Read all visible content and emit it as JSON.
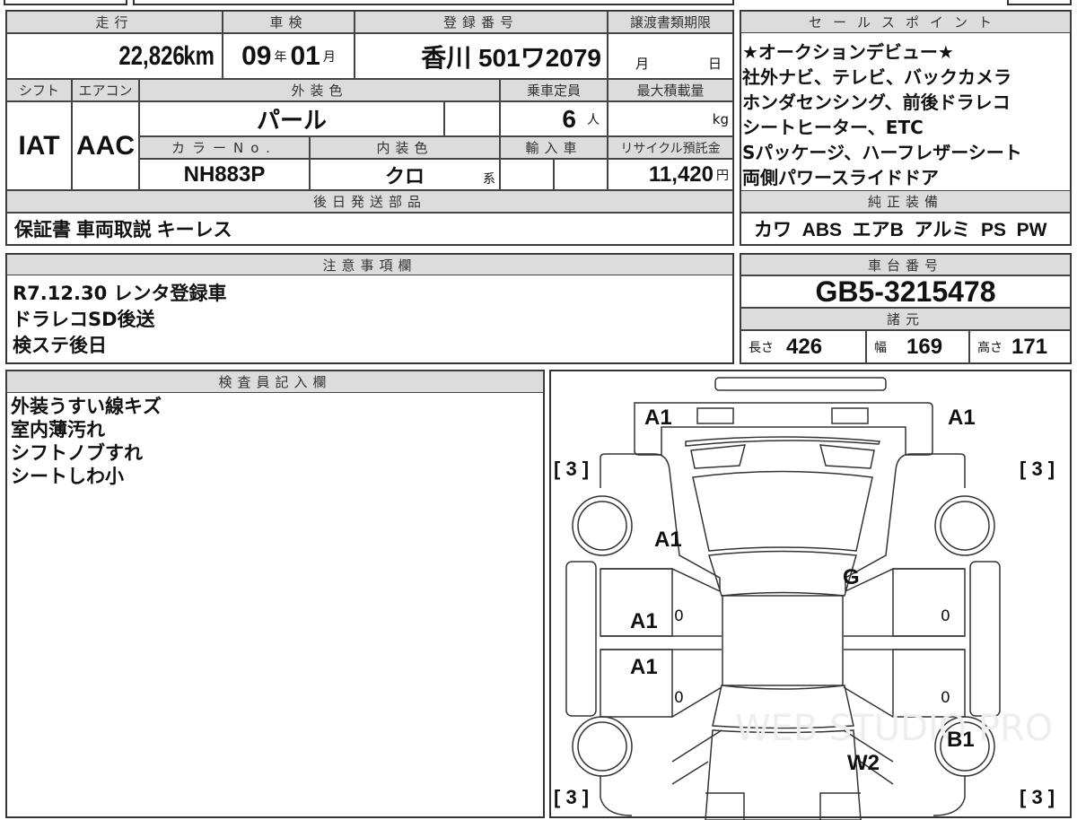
{
  "vehicle": {
    "mileage_label": "走行",
    "mileage": "22,826",
    "mileage_unit": "km",
    "inspection_label": "車検",
    "insp_year": "09",
    "year_unit": "年",
    "insp_month": "01",
    "month_unit": "月",
    "reg_label": "登録番号",
    "reg_number": "香川 501ワ2079",
    "transfer_label": "譲渡書類期限",
    "transfer_month": "月",
    "transfer_day": "日",
    "shift_label": "シフト",
    "shift": "IAT",
    "ac_label": "エアコン",
    "ac": "AAC",
    "ext_color_label": "外装色",
    "ext_color": "パール",
    "capacity_label": "乗車定員",
    "capacity": "6",
    "capacity_unit": "人",
    "max_load_label": "最大積載量",
    "max_load_unit": "kg",
    "color_no_label": "カラーNo.",
    "color_no": "NH883P",
    "int_color_label": "内装色",
    "int_color": "クロ",
    "int_color_unit": "系",
    "import_label": "輸入車",
    "recycle_label": "リサイクル預託金",
    "recycle": "11,420",
    "recycle_unit": "円",
    "parts_label": "後日発送部品",
    "parts": "保証書 車両取説 キーレス"
  },
  "sales": {
    "label": "セールスポイント",
    "text": "★オークションデビュー★\n社外ナビ、テレビ、バックカメラ\nホンダセンシング、前後ドラレコ\nシートヒーター、ETC\nSパッケージ、ハーフレザーシート\n両側パワースライドドア",
    "equip_label": "純正装備",
    "equip": "カワ  ABS  エアB  アルミ  PS  PW"
  },
  "notes": {
    "label": "注意事項欄",
    "text": "R7.12.30 レンタ登録車\nドラレコSD後送\n検ステ後日"
  },
  "chassis": {
    "label": "車台番号",
    "number": "GB5-3215478",
    "spec_label": "諸元",
    "length_label": "長さ",
    "length": "426",
    "width_label": "幅",
    "width": "169",
    "height_label": "高さ",
    "height": "171"
  },
  "inspector": {
    "label": "検査員記入欄",
    "text": "外装うすい線キズ\n室内薄汚れ\nシフトノブすれ\nシートしわ小"
  },
  "diagram": {
    "marks": [
      "A1",
      "A1",
      "A1",
      "G",
      "A1",
      "A1",
      "B1",
      "W2"
    ],
    "zeros": [
      "0",
      "0",
      "0",
      "0"
    ],
    "tires": [
      "[ 3 ]",
      "[ 3 ]",
      "[ 3 ]",
      "[ 3 ]"
    ],
    "watermark": "WEB STUDIO PRO"
  }
}
